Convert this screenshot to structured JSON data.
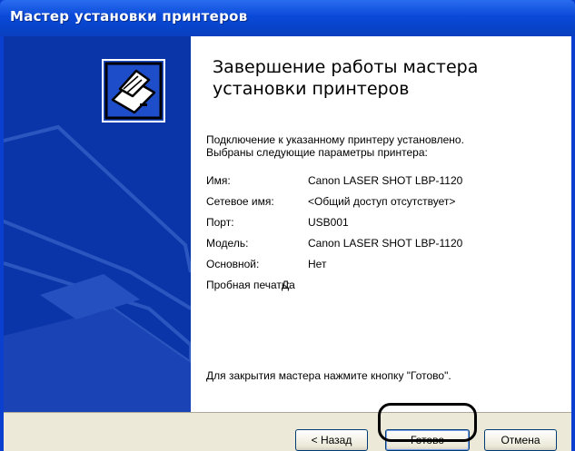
{
  "window": {
    "title": "Мастер установки принтеров"
  },
  "content": {
    "heading": "Завершение работы мастера установки принтеров",
    "intro_line1": "Подключение к указанному принтеру установлено.",
    "intro_line2": "Выбраны следующие параметры принтера:",
    "params": [
      {
        "key": "Имя:",
        "value": "Canon LASER SHOT LBP-1120"
      },
      {
        "key": "Сетевое имя:",
        "value": "<Общий доступ отсутствует>"
      },
      {
        "key": "Порт:",
        "value": "USB001"
      },
      {
        "key": "Модель:",
        "value": "Canon LASER SHOT LBP-1120"
      },
      {
        "key": "Основной:",
        "value": "Нет"
      },
      {
        "key": "Пробная печать:",
        "value": "Да"
      }
    ],
    "finish_hint": "Для закрытия мастера нажмите кнопку \"Готово\"."
  },
  "buttons": {
    "back": "< Назад",
    "finish": "Готово",
    "cancel": "Отмена"
  },
  "icons": {
    "wizard_icon": "printer-icon"
  },
  "colors": {
    "titlebar": "#0a49d8",
    "banner": "#0a35a8",
    "dialog_bg": "#ece9d8"
  }
}
